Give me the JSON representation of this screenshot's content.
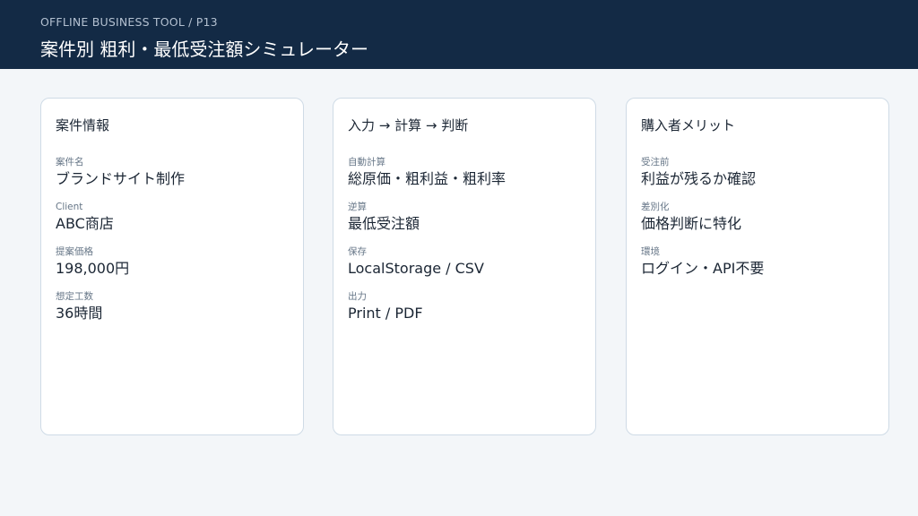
{
  "header": {
    "subtitle": "OFFLINE BUSINESS TOOL / P13",
    "title": "案件別 粗利・最低受注額シミュレーター"
  },
  "cards": [
    {
      "title": "案件情報",
      "fields": [
        {
          "label": "案件名",
          "value": "ブランドサイト制作"
        },
        {
          "label": "Client",
          "value": "ABC商店"
        },
        {
          "label": "提案価格",
          "value": "198,000円"
        },
        {
          "label": "想定工数",
          "value": "36時間"
        }
      ]
    },
    {
      "title": "入力 → 計算 → 判断",
      "fields": [
        {
          "label": "自動計算",
          "value": "総原価・粗利益・粗利率"
        },
        {
          "label": "逆算",
          "value": "最低受注額"
        },
        {
          "label": "保存",
          "value": "LocalStorage / CSV"
        },
        {
          "label": "出力",
          "value": "Print / PDF"
        }
      ]
    },
    {
      "title": "購入者メリット",
      "fields": [
        {
          "label": "受注前",
          "value": "利益が残るか確認"
        },
        {
          "label": "差別化",
          "value": "価格判断に特化"
        },
        {
          "label": "環境",
          "value": "ログイン・API不要"
        }
      ]
    }
  ]
}
